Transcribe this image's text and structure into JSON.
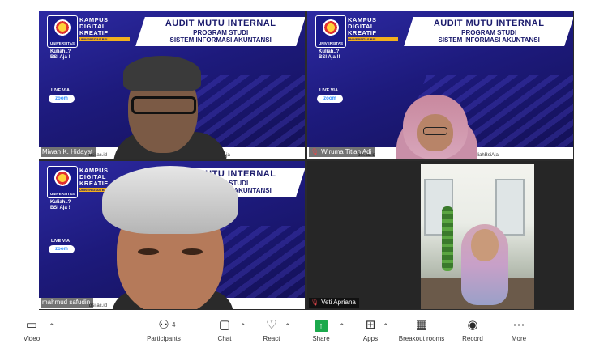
{
  "slide": {
    "brand": "KAMPUS DIGITAL KREATIF",
    "brand_sub": "UNIVERSITAS BSI",
    "logo_text": "UNIVERSITAS",
    "slogan_1": "Kuliah..?",
    "slogan_2": "BSI Aja !!",
    "title_1": "AUDIT MUTU INTERNAL",
    "title_2": "PROGRAM STUDI",
    "title_3": "SISTEM INFORMASI AKUNTANSI",
    "live_via": "LIVE VIA",
    "zoom": "zoom",
    "band_1": "bsi.ac.id",
    "band_2": "@KuliahBsiAja"
  },
  "participants": [
    {
      "name": "Miwan K. Hidayat",
      "muted": false
    },
    {
      "name": "Wiruma Titian Adi",
      "muted": true
    },
    {
      "name": "mahmud safudin",
      "muted": false,
      "active_speaker": true
    },
    {
      "name": "Veti Apriana",
      "muted": true
    }
  ],
  "toolbar": {
    "video": "Video",
    "participants": "Participants",
    "participants_count": "4",
    "chat": "Chat",
    "react": "React",
    "share": "Share",
    "apps": "Apps",
    "breakout": "Breakout rooms",
    "record": "Record",
    "more": "More"
  },
  "icons": {
    "video": "video-camera-icon",
    "participants": "people-icon",
    "chat": "chat-bubble-icon",
    "react": "heart-icon",
    "share": "share-screen-icon",
    "apps": "apps-icon",
    "breakout": "grid-icon",
    "record": "record-icon",
    "more": "more-icon",
    "muted": "mic-muted-icon"
  },
  "colors": {
    "active_outline": "#1ed9b4",
    "share_green": "#1ba94c",
    "mute_red": "#e5484d",
    "slide_blue": "#1d1a7c"
  }
}
